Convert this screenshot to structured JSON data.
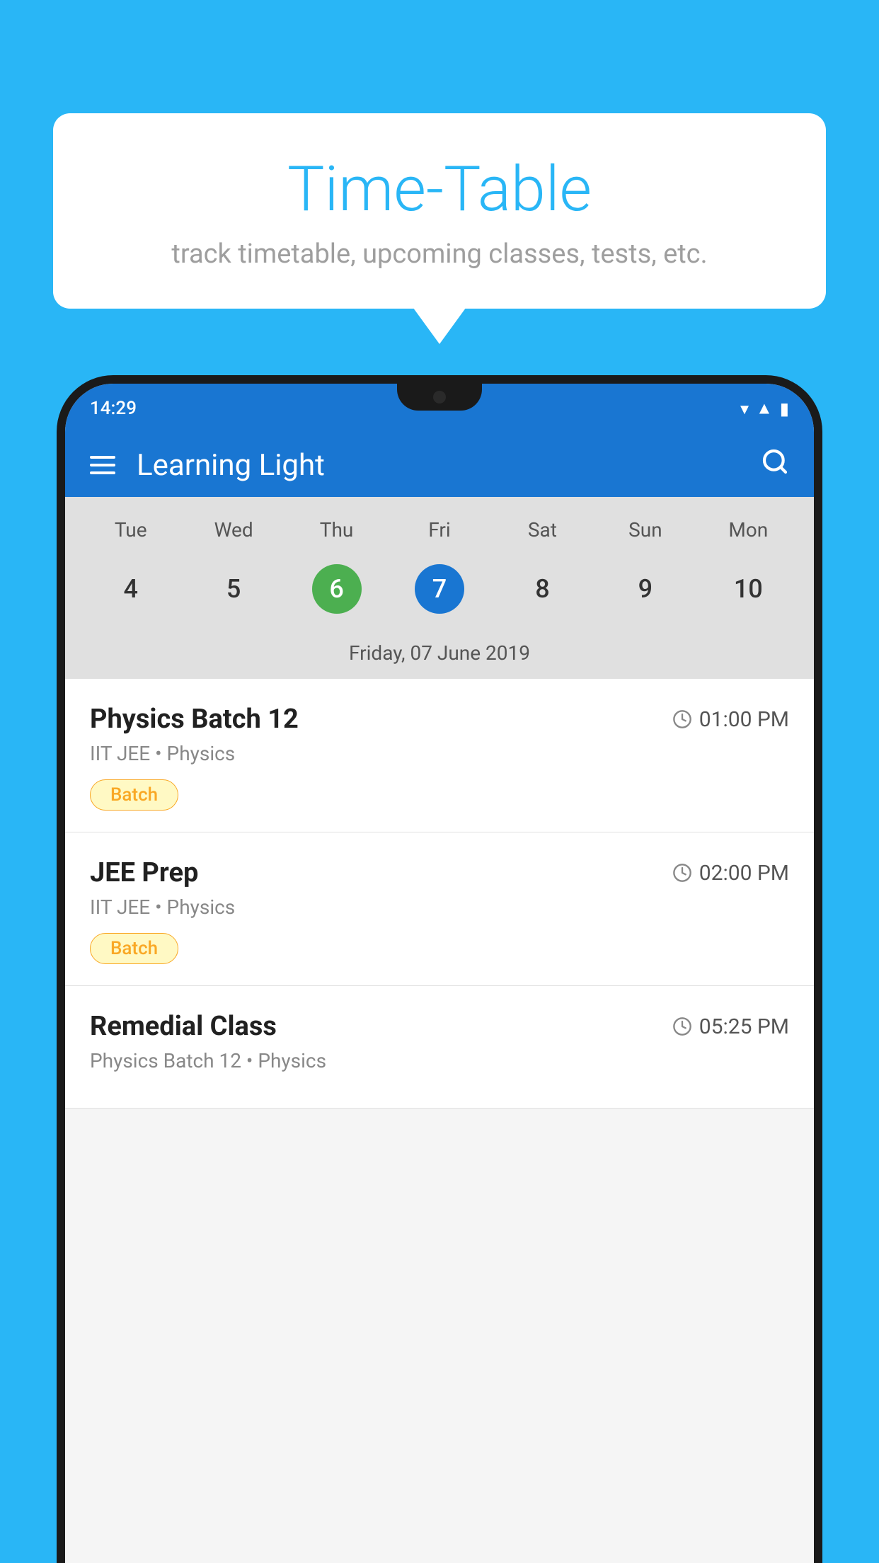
{
  "background_color": "#29B6F6",
  "bubble": {
    "title": "Time-Table",
    "subtitle": "track timetable, upcoming classes, tests, etc."
  },
  "phone": {
    "status_bar": {
      "time": "14:29",
      "icons": [
        "wifi",
        "signal",
        "battery"
      ]
    },
    "app_header": {
      "title": "Learning Light"
    },
    "calendar": {
      "days": [
        "Tue",
        "Wed",
        "Thu",
        "Fri",
        "Sat",
        "Sun",
        "Mon"
      ],
      "dates": [
        {
          "number": "4",
          "state": "normal"
        },
        {
          "number": "5",
          "state": "normal"
        },
        {
          "number": "6",
          "state": "today"
        },
        {
          "number": "7",
          "state": "selected"
        },
        {
          "number": "8",
          "state": "normal"
        },
        {
          "number": "9",
          "state": "normal"
        },
        {
          "number": "10",
          "state": "normal"
        }
      ],
      "selected_date_label": "Friday, 07 June 2019"
    },
    "schedule": [
      {
        "name": "Physics Batch 12",
        "time": "01:00 PM",
        "meta": "IIT JEE • Physics",
        "tag": "Batch"
      },
      {
        "name": "JEE Prep",
        "time": "02:00 PM",
        "meta": "IIT JEE • Physics",
        "tag": "Batch"
      },
      {
        "name": "Remedial Class",
        "time": "05:25 PM",
        "meta": "Physics Batch 12 • Physics",
        "tag": ""
      }
    ]
  }
}
